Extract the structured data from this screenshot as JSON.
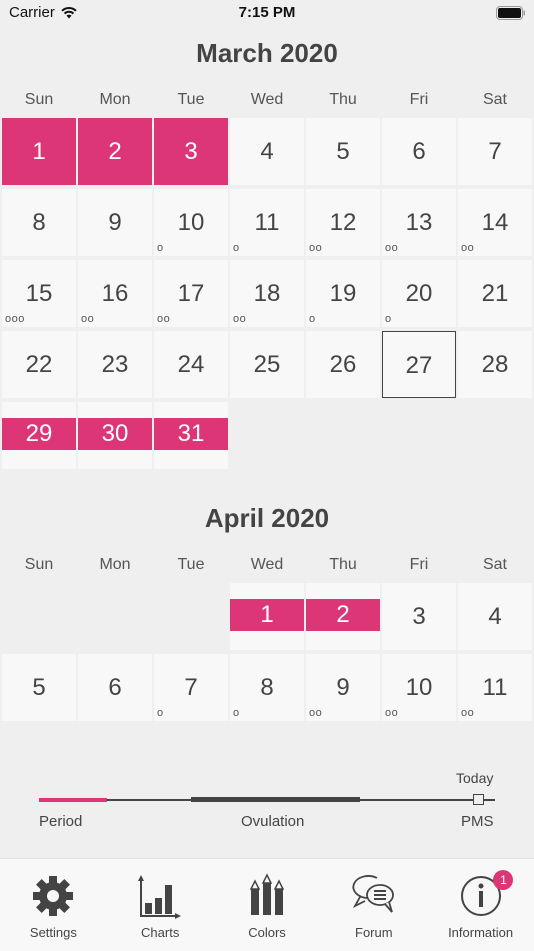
{
  "status_bar": {
    "carrier": "Carrier",
    "time": "7:15 PM"
  },
  "weekdays": [
    "Sun",
    "Mon",
    "Tue",
    "Wed",
    "Thu",
    "Fri",
    "Sat"
  ],
  "colors": {
    "period": "#dc3677",
    "text": "#444444",
    "background": "#efefef"
  },
  "months": [
    {
      "title": "March 2020",
      "leading_blanks": 0,
      "days": [
        {
          "d": "1",
          "state": "period-full",
          "dots": ""
        },
        {
          "d": "2",
          "state": "period-full",
          "dots": ""
        },
        {
          "d": "3",
          "state": "period-full",
          "dots": ""
        },
        {
          "d": "4",
          "state": "",
          "dots": ""
        },
        {
          "d": "5",
          "state": "",
          "dots": ""
        },
        {
          "d": "6",
          "state": "",
          "dots": ""
        },
        {
          "d": "7",
          "state": "",
          "dots": ""
        },
        {
          "d": "8",
          "state": "",
          "dots": ""
        },
        {
          "d": "9",
          "state": "",
          "dots": ""
        },
        {
          "d": "10",
          "state": "",
          "dots": "o"
        },
        {
          "d": "11",
          "state": "",
          "dots": "o"
        },
        {
          "d": "12",
          "state": "",
          "dots": "oo"
        },
        {
          "d": "13",
          "state": "",
          "dots": "oo"
        },
        {
          "d": "14",
          "state": "",
          "dots": "oo"
        },
        {
          "d": "15",
          "state": "",
          "dots": "ooo"
        },
        {
          "d": "16",
          "state": "",
          "dots": "oo"
        },
        {
          "d": "17",
          "state": "",
          "dots": "oo"
        },
        {
          "d": "18",
          "state": "",
          "dots": "oo"
        },
        {
          "d": "19",
          "state": "",
          "dots": "o"
        },
        {
          "d": "20",
          "state": "",
          "dots": "o"
        },
        {
          "d": "21",
          "state": "",
          "dots": ""
        },
        {
          "d": "22",
          "state": "",
          "dots": ""
        },
        {
          "d": "23",
          "state": "",
          "dots": ""
        },
        {
          "d": "24",
          "state": "",
          "dots": ""
        },
        {
          "d": "25",
          "state": "",
          "dots": ""
        },
        {
          "d": "26",
          "state": "",
          "dots": ""
        },
        {
          "d": "27",
          "state": "today",
          "dots": ""
        },
        {
          "d": "28",
          "state": "",
          "dots": ""
        },
        {
          "d": "29",
          "state": "period-band",
          "dots": ""
        },
        {
          "d": "30",
          "state": "period-band",
          "dots": ""
        },
        {
          "d": "31",
          "state": "period-band",
          "dots": ""
        }
      ]
    },
    {
      "title": "April 2020",
      "leading_blanks": 3,
      "days": [
        {
          "d": "1",
          "state": "period-band",
          "dots": ""
        },
        {
          "d": "2",
          "state": "period-band",
          "dots": ""
        },
        {
          "d": "3",
          "state": "",
          "dots": ""
        },
        {
          "d": "4",
          "state": "",
          "dots": ""
        },
        {
          "d": "5",
          "state": "",
          "dots": ""
        },
        {
          "d": "6",
          "state": "",
          "dots": ""
        },
        {
          "d": "7",
          "state": "",
          "dots": "o"
        },
        {
          "d": "8",
          "state": "",
          "dots": "o"
        },
        {
          "d": "9",
          "state": "",
          "dots": "oo"
        },
        {
          "d": "10",
          "state": "",
          "dots": "oo"
        },
        {
          "d": "11",
          "state": "",
          "dots": "oo"
        }
      ]
    }
  ],
  "legend": {
    "today": "Today",
    "period": "Period",
    "ovulation": "Ovulation",
    "pms": "PMS"
  },
  "tabs": [
    {
      "label": "Settings",
      "icon": "gear-icon"
    },
    {
      "label": "Charts",
      "icon": "bar-chart-icon"
    },
    {
      "label": "Colors",
      "icon": "pencils-icon"
    },
    {
      "label": "Forum",
      "icon": "chat-bubbles-icon"
    },
    {
      "label": "Information",
      "icon": "info-icon",
      "badge": "1"
    }
  ]
}
